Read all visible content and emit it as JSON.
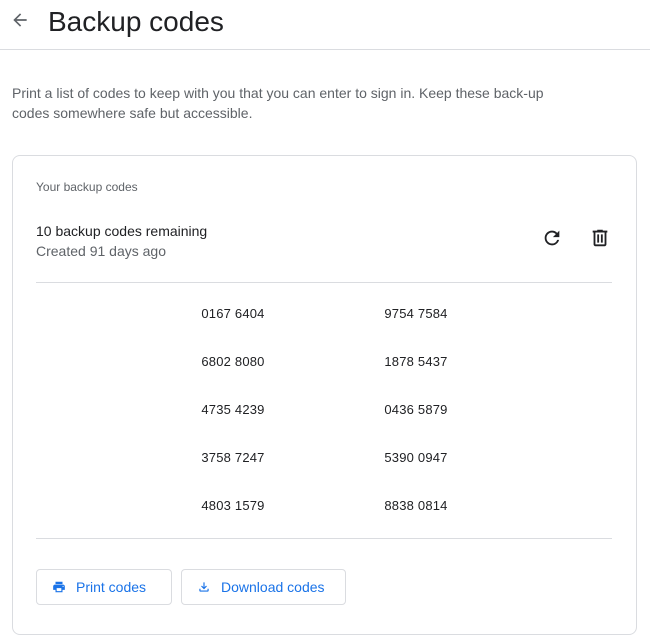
{
  "header": {
    "title": "Backup codes",
    "back_icon": "arrow-back-icon"
  },
  "description": "Print a list of codes to keep with you that you can enter to sign in. Keep these back-up codes somewhere safe but accessible.",
  "card": {
    "label": "Your backup codes",
    "remaining": "10 backup codes remaining",
    "created": "Created 91 days ago",
    "icons": {
      "refresh": "refresh-icon",
      "delete": "trash-icon"
    },
    "codes": [
      "0167 6404",
      "9754 7584",
      "6802 8080",
      "1878 5437",
      "4735 4239",
      "0436 5879",
      "3758 7247",
      "5390 0947",
      "4803 1579",
      "8838 0814"
    ]
  },
  "buttons": {
    "print_label": "Print codes",
    "download_label": "Download codes",
    "print_icon": "printer-icon",
    "download_icon": "download-icon"
  },
  "colors": {
    "accent": "#1a73e8",
    "text_primary": "#202124",
    "text_secondary": "#5f6368",
    "border": "#dadce0"
  }
}
